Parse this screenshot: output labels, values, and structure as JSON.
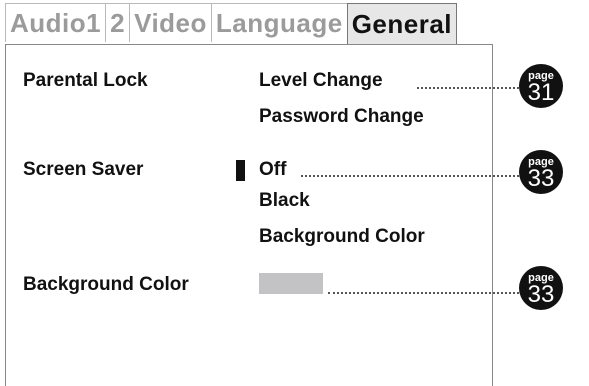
{
  "tabs": [
    {
      "label": "Audio1",
      "active": false
    },
    {
      "label": "2",
      "active": false
    },
    {
      "label": "Video",
      "active": false
    },
    {
      "label": "Language",
      "active": false
    },
    {
      "label": "General",
      "active": true
    }
  ],
  "settings": {
    "parental_lock": {
      "label": "Parental  Lock",
      "options": [
        "Level  Change",
        "Password  Change"
      ],
      "page_ref": {
        "word": "page",
        "number": "31"
      }
    },
    "screen_saver": {
      "label": "Screen  Saver",
      "options": [
        "Off",
        "Black",
        "Background  Color"
      ],
      "selected": "Off",
      "page_ref": {
        "word": "page",
        "number": "33"
      }
    },
    "background_color": {
      "label": "Background  Color",
      "swatch_color": "#c3c3c6",
      "page_ref": {
        "word": "page",
        "number": "33"
      }
    }
  },
  "colors": {
    "accent": "#111111",
    "inactive_tab_text": "#9b9b9b",
    "active_tab_bg": "#e7e7e7"
  }
}
